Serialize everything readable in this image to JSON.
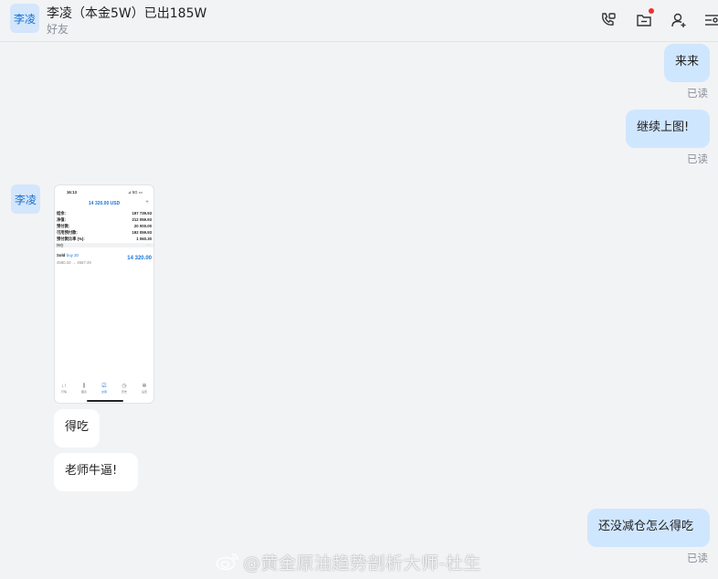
{
  "header": {
    "avatar_text": "李凌",
    "title": "李凌（本金5W）已出185W",
    "subtitle": "好友",
    "icons": [
      "phone-video-icon",
      "folder-icon",
      "add-user-icon",
      "menu-icon"
    ]
  },
  "messages": [
    {
      "side": "me",
      "text": "来来",
      "status": "已读"
    },
    {
      "side": "me",
      "text": "继续上图!",
      "status": "已读"
    },
    {
      "side": "them",
      "avatar": "李凌",
      "type": "image"
    },
    {
      "side": "them",
      "text": "得吃"
    },
    {
      "side": "them",
      "text": "老师牛逼!"
    },
    {
      "side": "me",
      "text": "还没减仓怎么得吃",
      "status": "已读"
    }
  ],
  "screenshot": {
    "time": "16:13",
    "status": "⊿ 5G ▭",
    "balance_header": "14 320.00 USD",
    "plus": "+",
    "rows": [
      {
        "label": "结余:",
        "value": "197 739.93"
      },
      {
        "label": "净值:",
        "value": "212 059.93"
      },
      {
        "label": "预付款:",
        "value": "20 000.00"
      },
      {
        "label": "可用预付款:",
        "value": "192 059.93"
      },
      {
        "label": "预付款比率 (%):",
        "value": "1 060.30"
      }
    ],
    "section": "持仓",
    "dots": "···",
    "position_title": "Sold",
    "position_detail": "buy 20",
    "position_prices": "4580.33 → 4567.49",
    "position_profit": "14 320.00",
    "tabs": [
      "行情",
      "图表",
      "交易",
      "历史",
      "设置"
    ]
  },
  "watermark": "@黄金原油趋势剖析大师-杜生"
}
